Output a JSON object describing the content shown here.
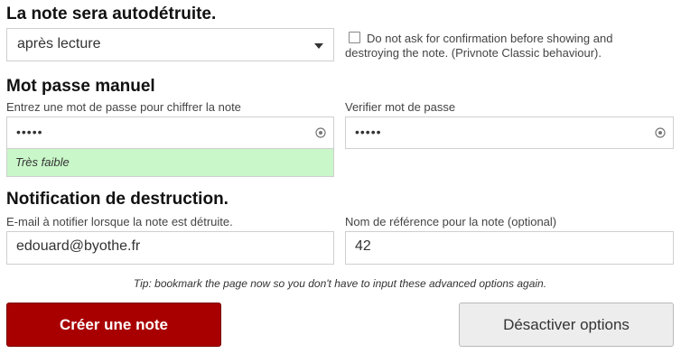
{
  "destroy_section": {
    "title": "La note sera autodétruite.",
    "selected_option": "après lecture",
    "confirm_checkbox_label": "Do not ask for confirmation before showing and destroying the note. (Privnote Classic behaviour).",
    "confirm_checked": false
  },
  "password_section": {
    "title": "Mot passe manuel",
    "password_label": "Entrez une mot de passe pour chiffrer la note",
    "password_value": "•••••",
    "verify_label": "Verifier mot de passe",
    "verify_value": "•••••",
    "strength_text": "Très faible"
  },
  "notification_section": {
    "title": "Notification de destruction.",
    "email_label": "E-mail à notifier lorsque la note est détruite.",
    "email_value": "edouard@byothe.fr",
    "reference_label": "Nom de référence pour la note (optional)",
    "reference_value": "42"
  },
  "tip": "Tip: bookmark the page now so you don't have to input these advanced options again.",
  "buttons": {
    "create_label": "Créer une note",
    "disable_label": "Désactiver options"
  },
  "colors": {
    "primary_button": "#a80000",
    "strength_weak": "#c9f7c9"
  },
  "icons": {
    "password_reveal": "eye-icon",
    "select_caret": "caret-down-icon"
  }
}
